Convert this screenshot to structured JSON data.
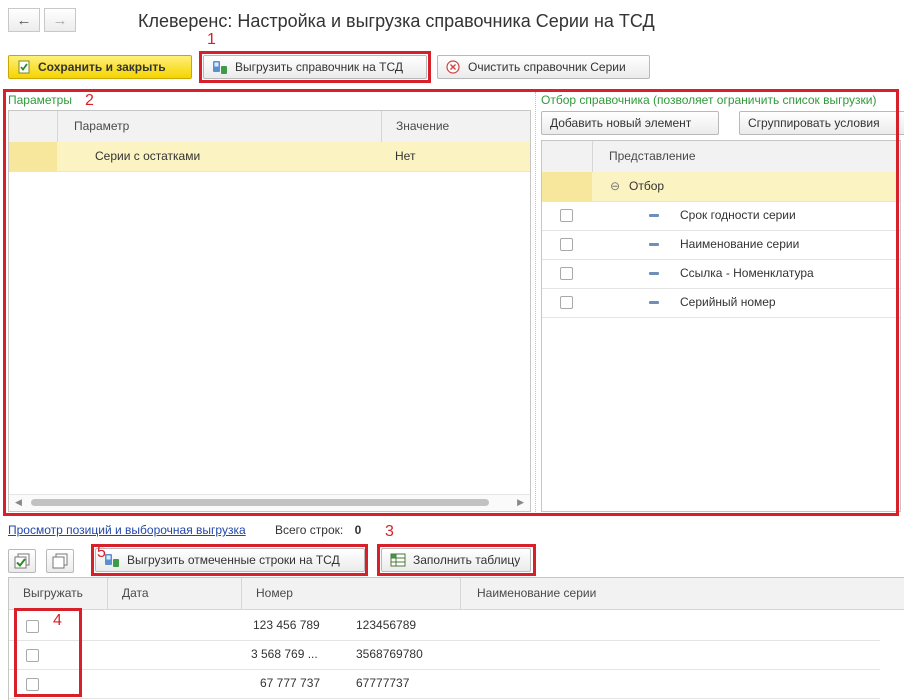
{
  "nav": {
    "back_icon": "←",
    "forward_icon": "→"
  },
  "window": {
    "title": "Клеверенс: Настройка и выгрузка справочника Серии на ТСД"
  },
  "toolbar": {
    "save_close_label": "Сохранить и закрыть",
    "upload_label": "Выгрузить справочник на ТСД",
    "clear_label": "Очистить справочник Серии"
  },
  "annotations": [
    "1",
    "2",
    "3",
    "4",
    "5"
  ],
  "params": {
    "label": "Параметры",
    "columns": [
      "Параметр",
      "Значение"
    ],
    "rows": [
      {
        "param": "Серии с остатками",
        "value": "Нет"
      }
    ]
  },
  "filter": {
    "label": "Отбор справочника (позволяет ограничить список выгрузки)",
    "add_label": "Добавить новый элемент",
    "group_label": "Сгруппировать условия",
    "column": "Представление",
    "group_row": "Отбор",
    "items": [
      "Срок годности серии",
      "Наименование серии",
      "Ссылка - Номенклатура",
      "Серийный номер"
    ]
  },
  "bottom": {
    "link_label": "Просмотр позиций и выборочная выгрузка",
    "total_label": "Всего строк:",
    "total_value": "0",
    "upload_marked_label": "Выгрузить отмеченные строки на ТСД",
    "fill_label": "Заполнить таблицу"
  },
  "table": {
    "columns": [
      "Выгружать",
      "Дата",
      "Номер",
      "Наименование серии"
    ],
    "rows": [
      {
        "number": "123 456 789",
        "name": "123456789"
      },
      {
        "number": "3 568 769 ...",
        "name": "3568769780"
      },
      {
        "number": "67 777 737",
        "name": "67777737"
      }
    ]
  }
}
